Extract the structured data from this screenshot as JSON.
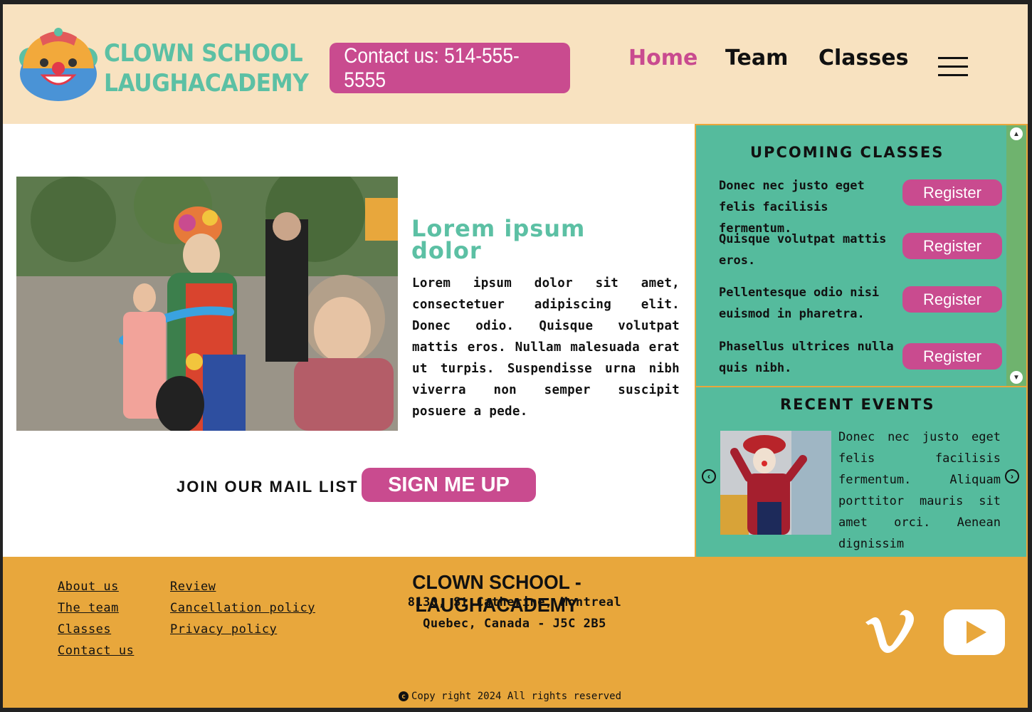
{
  "brand": {
    "line1": "CLOWN SCHOOL",
    "line2": "LAUGHACADEMY"
  },
  "header": {
    "contact": "Contact us: 514-555-5555",
    "nav": {
      "home": "Home",
      "team": "Team",
      "classes": "Classes"
    }
  },
  "hero": {
    "title_line1": "Lorem ipsum",
    "title_line2": "dolor",
    "body": "Lorem ipsum dolor sit amet, consectetuer adipiscing elit. Donec odio. Quisque volutpat mattis eros. Nullam malesuada erat ut turpis. Suspendisse urna nibh viverra non semper suscipit posuere a pede."
  },
  "mailing": {
    "label": "JOIN OUR MAIL LIST",
    "button": "SIGN ME UP"
  },
  "upcoming": {
    "title": "UPCOMING CLASSES",
    "items": [
      {
        "text": "Donec nec justo eget felis facilisis fermentum.",
        "button": "Register"
      },
      {
        "text": "Quisque volutpat mattis eros.",
        "button": "Register"
      },
      {
        "text": "Pellentesque odio nisi euismod in pharetra.",
        "button": "Register"
      },
      {
        "text": "Phasellus ultrices nulla quis nibh.",
        "button": "Register"
      }
    ]
  },
  "events": {
    "title": "RECENT EVENTS",
    "text": "Donec nec justo eget felis facilisis fermentum. Aliquam porttitor mauris sit amet orci. Aenean dignissim pellentesque."
  },
  "footer": {
    "links_col1": [
      "About us",
      "The team",
      "Classes",
      "Contact us"
    ],
    "links_col2": [
      "Review",
      "Cancellation policy",
      "Privacy policy"
    ],
    "title": "CLOWN SCHOOL - LAUGHACADEMY",
    "address1": "8130, St.Catherine, Montreal",
    "address2": "Quebec, Canada - J5C 2B5",
    "copyright": "Copy right 2024 All rights reserved"
  },
  "colors": {
    "header_bg": "#f8e2c0",
    "accent_pink": "#c94b8f",
    "accent_teal": "#5cc0a4",
    "sidebar_bg": "#55bb9d",
    "footer_bg": "#e8a73c"
  },
  "icons": [
    "clown-logo-icon",
    "hamburger-menu-icon",
    "scroll-up-icon",
    "scroll-down-icon",
    "carousel-prev-icon",
    "carousel-next-icon",
    "vimeo-icon",
    "youtube-icon",
    "copyright-icon"
  ]
}
